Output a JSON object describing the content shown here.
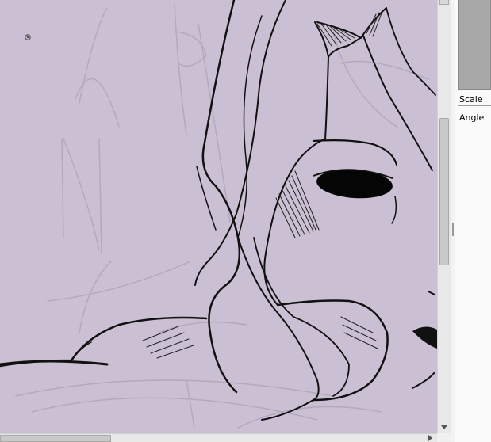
{
  "canvas": {
    "background_color": "#cbc0d3",
    "ink_color": "#111111",
    "sketch_color": "#b3a8bd"
  },
  "panel": {
    "scale_label": "Scale",
    "angle_label": "Angle"
  },
  "icons": {
    "brush_cursor": "brush-cursor-icon",
    "scroll_down": "triangle-down-icon",
    "scroll_right": "triangle-right-icon",
    "splitter_grip": "grip-icon"
  }
}
